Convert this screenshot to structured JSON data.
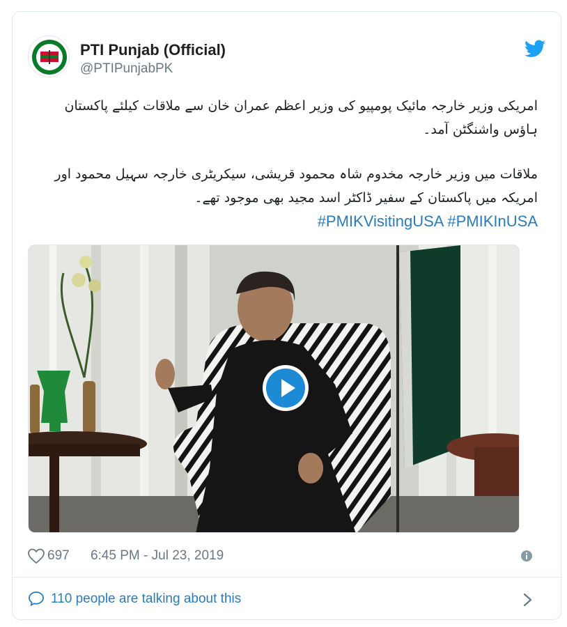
{
  "tweet": {
    "author_name": "PTI Punjab (Official)",
    "author_handle": "@PTIPunjabPK",
    "paragraph_1": "امریکی وزیر خارجہ مائیک پومپیو کی وزیر اعظم عمران خان سے ملاقات کیلئے پاکستان ہاؤس واشنگٹن آمد۔",
    "paragraph_2": "ملاقات میں وزیر خارجہ مخدوم شاہ محمود قریشی، سیکریٹری خارجہ سہیل محمود اور امریکہ میں پاکستان کے سفیر ڈاکٹر اسد مجید بھی موجود تھے۔",
    "hashtags": [
      "#PMIKVisitingUSA",
      "#PMIKInUSA"
    ],
    "likes": "697",
    "timestamp": "6:45 PM - Jul 23, 2019",
    "talking_about": "110 people are talking about this"
  },
  "colors": {
    "link": "#2b7bb9",
    "twitter_blue": "#1da1f2",
    "muted": "#697882",
    "border": "#e1e8ed",
    "play_button": "#1d8ad6"
  },
  "icons": {
    "brand": "twitter-bird-icon",
    "like": "heart-icon",
    "info": "info-icon",
    "reply": "speech-bubble-icon",
    "more": "chevron-right-icon",
    "media": "play-icon"
  }
}
